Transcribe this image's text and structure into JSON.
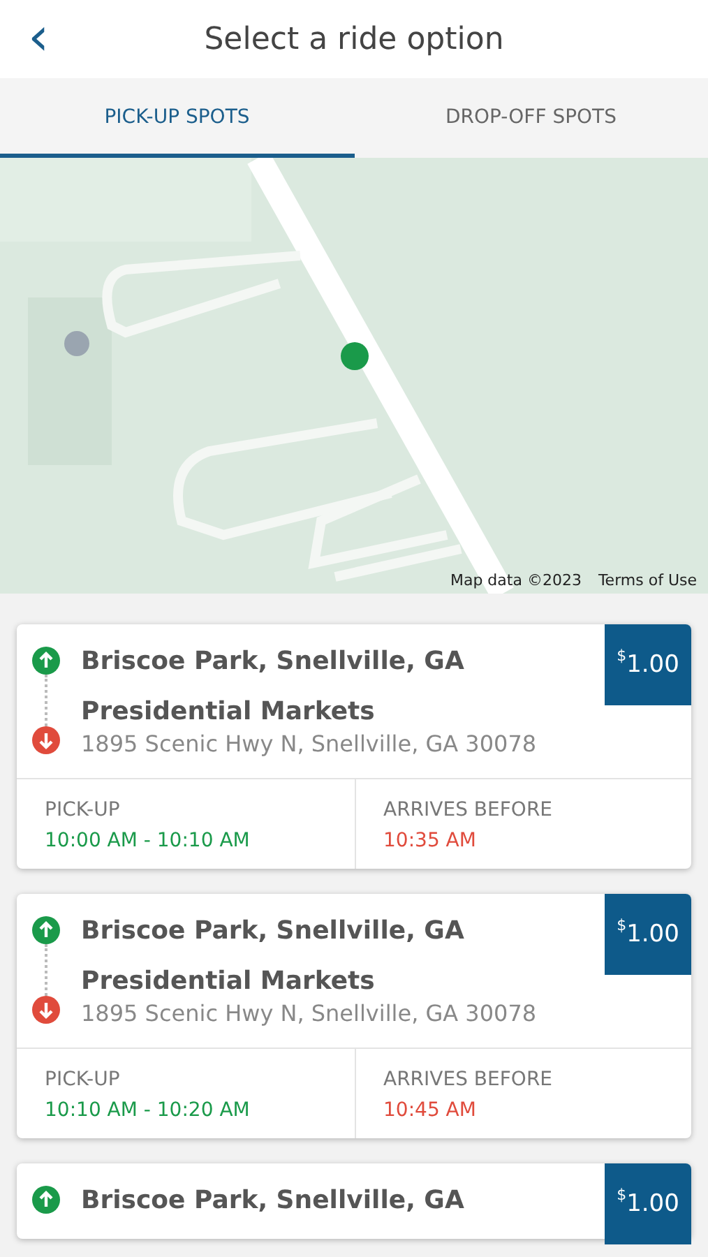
{
  "header": {
    "back": "‹",
    "title": "Select a ride option"
  },
  "tabs": [
    {
      "label": "PICK-UP SPOTS",
      "selected": true
    },
    {
      "label": "DROP-OFF SPOTS",
      "selected": false
    }
  ],
  "map": {
    "kind": "picture",
    "attribution": "Map data ©2023",
    "terms": "Terms of Use"
  },
  "rides": [
    {
      "pickup": "Briscoe Park, Snellville, GA",
      "dropoff": "Presidential Markets",
      "address": "1895 Scenic Hwy N, Snellville, GA 30078",
      "currency": "$",
      "amount": "1.00",
      "pickup_label": "PICK-UP",
      "pickup_time": "10:00 AM - 10:10 AM",
      "arrive_label": "ARRIVES BEFORE",
      "arrive_time": "10:35 AM"
    },
    {
      "pickup": "Briscoe Park, Snellville, GA",
      "dropoff": "Presidential Markets",
      "address": "1895 Scenic Hwy N, Snellville, GA 30078",
      "currency": "$",
      "amount": "1.00",
      "pickup_label": "PICK-UP",
      "pickup_time": "10:10 AM - 10:20 AM",
      "arrive_label": "ARRIVES BEFORE",
      "arrive_time": "10:45 AM"
    },
    {
      "pickup": "Briscoe Park, Snellville, GA",
      "currency": "$",
      "amount": "1.00"
    }
  ]
}
